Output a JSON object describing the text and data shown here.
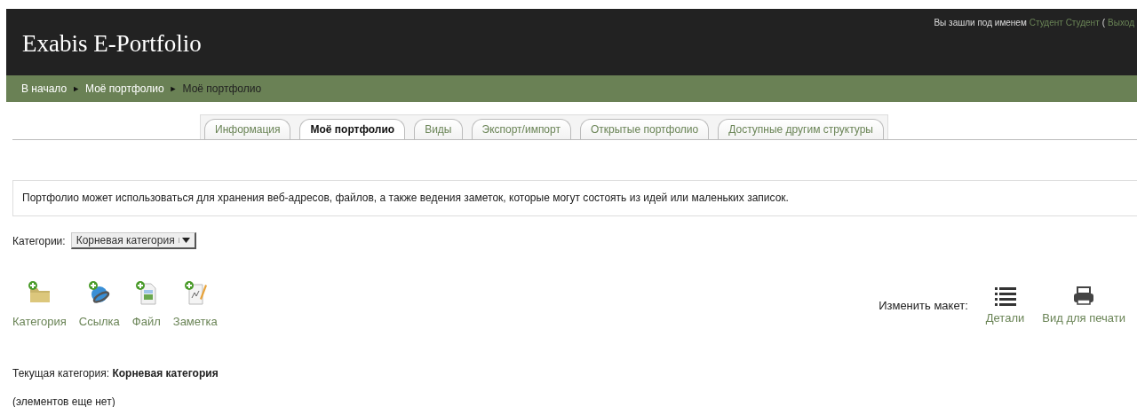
{
  "header": {
    "title": "Exabis E-Portfolio",
    "login": {
      "prefix": "Вы зашли под именем",
      "user": "Студент Студент",
      "open_paren": "(",
      "logout": "Выход"
    }
  },
  "breadcrumb": {
    "separator": "►",
    "items": [
      {
        "label": "В начало",
        "current": false
      },
      {
        "label": "Моё портфолио",
        "current": false
      },
      {
        "label": "Моё портфолио",
        "current": true
      }
    ]
  },
  "tabs": [
    {
      "label": "Информация",
      "selected": false
    },
    {
      "label": "Моё портфолио",
      "selected": true
    },
    {
      "label": "Виды",
      "selected": false
    },
    {
      "label": "Экспорт/импорт",
      "selected": false
    },
    {
      "label": "Открытые портфолио",
      "selected": false
    },
    {
      "label": "Доступные другим структуры",
      "selected": false
    }
  ],
  "info": "Портфолио может использоваться для хранения веб-адресов, файлов, а также ведения заметок, которые могут состоять из идей или маленьких записок.",
  "category_select": {
    "label": "Категории:",
    "value": "Корневая категория"
  },
  "add_actions": [
    {
      "kind": "category",
      "label": "Категория"
    },
    {
      "kind": "link",
      "label": "Ссылка"
    },
    {
      "kind": "file",
      "label": "Файл"
    },
    {
      "kind": "note",
      "label": "Заметка"
    }
  ],
  "layout": {
    "label": "Изменить макет:",
    "options": [
      {
        "kind": "details",
        "label": "Детали"
      },
      {
        "kind": "print",
        "label": "Вид для печати"
      }
    ]
  },
  "current_category": {
    "label": "Текущая категория:",
    "value": "Корневая категория"
  },
  "empty_note": "(элементов еще нет)"
}
